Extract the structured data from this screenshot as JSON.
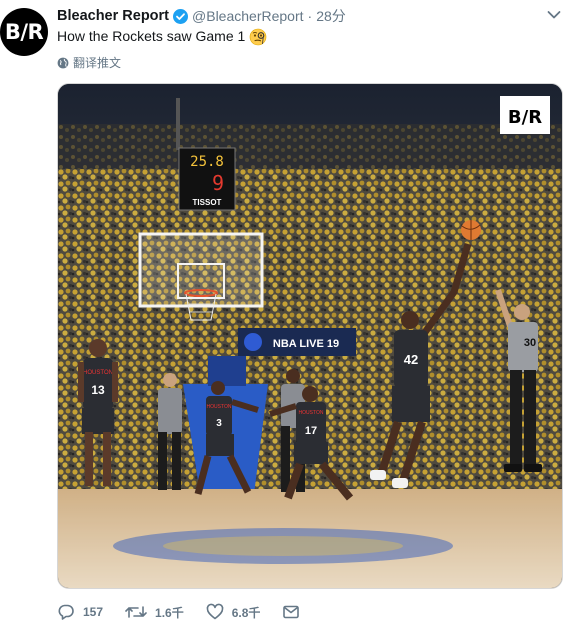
{
  "author": {
    "avatar_text": "B/R",
    "display_name": "Bleacher Report",
    "handle": "@BleacherReport",
    "separator": "·",
    "time": "28分"
  },
  "tweet": {
    "text": "How the Rockets saw Game 1",
    "emoji": "monocle-face-emoji",
    "translate_label": "翻译推文"
  },
  "photo": {
    "logo_text": "B/R",
    "shot_clock": {
      "top": "25.8",
      "bottom": "9",
      "sponsor": "TISSOT"
    },
    "ad_banner": "NBA LIVE 19",
    "jerseys": [
      {
        "team": "HOUSTON",
        "number": "13"
      },
      {
        "team": "HOUSTON",
        "number": "3"
      },
      {
        "team": "HOUSTON",
        "number": "17"
      },
      {
        "team": "",
        "number": "42"
      },
      {
        "team": "",
        "number": "30"
      }
    ]
  },
  "actions": {
    "reply_count": "157",
    "retweet_count": "1.6千",
    "like_count": "6.8千"
  },
  "colors": {
    "link_gray": "#657786",
    "verified_blue": "#1da1f2",
    "crowd_gold": "#d9b23a",
    "court_wood": "#c8a472"
  }
}
